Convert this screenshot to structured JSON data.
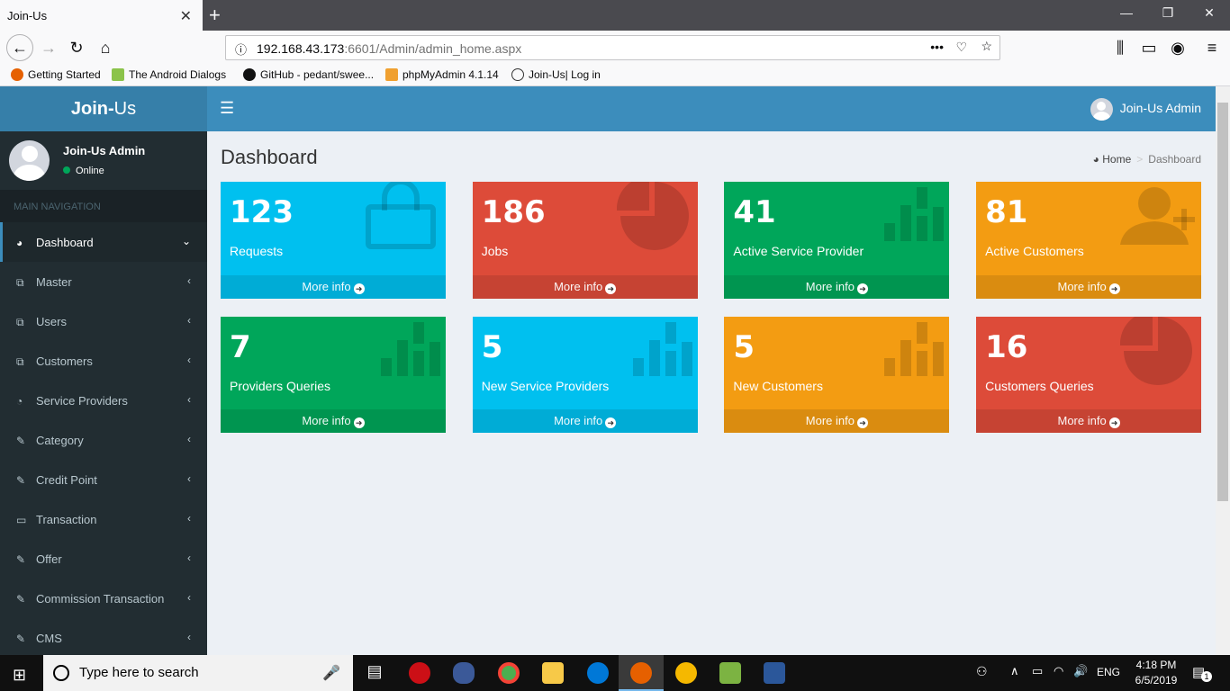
{
  "browser": {
    "tab_title": "Join-Us",
    "url_host": "192.168.43.173",
    "url_rest": ":6601/Admin/admin_home.aspx",
    "bookmarks": [
      "Getting Started",
      "The Android  Dialogs",
      "GitHub - pedant/swee...",
      "phpMyAdmin 4.1.14",
      "Join-Us| Log in"
    ]
  },
  "app": {
    "brand_bold": "Join-",
    "brand_light": "Us",
    "top_user": "Join-Us Admin",
    "sidebar_user": "Join-Us Admin",
    "status": "Online",
    "nav_header": "MAIN NAVIGATION",
    "menu": [
      {
        "label": "Dashboard",
        "icon": "dashboard-icon"
      },
      {
        "label": "Master",
        "icon": "copy-icon"
      },
      {
        "label": "Users",
        "icon": "copy-icon"
      },
      {
        "label": "Customers",
        "icon": "copy-icon"
      },
      {
        "label": "Service Providers",
        "icon": "pie-chart-icon"
      },
      {
        "label": "Category",
        "icon": "edit-icon"
      },
      {
        "label": "Credit Point",
        "icon": "edit-icon"
      },
      {
        "label": "Transaction",
        "icon": "laptop-icon"
      },
      {
        "label": "Offer",
        "icon": "edit-icon"
      },
      {
        "label": "Commission Transaction",
        "icon": "edit-icon"
      },
      {
        "label": "CMS",
        "icon": "edit-icon"
      }
    ]
  },
  "content": {
    "title": "Dashboard",
    "breadcrumb_home": "Home",
    "breadcrumb_current": "Dashboard",
    "more_info": "More info",
    "boxes": [
      {
        "value": "123",
        "label": "Requests",
        "color": "#00c0ef",
        "icon": "shopping-bag-icon"
      },
      {
        "value": "186",
        "label": "Jobs",
        "color": "#dd4b39",
        "icon": "pie-chart-icon"
      },
      {
        "value": "41",
        "label": "Active Service Provider",
        "color": "#00a65a",
        "icon": "bar-chart-icon"
      },
      {
        "value": "81",
        "label": "Active Customers",
        "color": "#f39c12",
        "icon": "user-plus-icon"
      },
      {
        "value": "7",
        "label": "Providers Queries",
        "color": "#00a65a",
        "icon": "bar-chart-icon"
      },
      {
        "value": "5",
        "label": "New Service Providers",
        "color": "#00c0ef",
        "icon": "bar-chart-icon"
      },
      {
        "value": "5",
        "label": "New Customers",
        "color": "#f39c12",
        "icon": "bar-chart-icon"
      },
      {
        "value": "16",
        "label": "Customers Queries",
        "color": "#dd4b39",
        "icon": "pie-chart-icon"
      }
    ]
  },
  "taskbar": {
    "search_placeholder": "Type here to search",
    "lang": "ENG",
    "time": "4:18 PM",
    "date": "6/5/2019",
    "notification_count": "1"
  }
}
